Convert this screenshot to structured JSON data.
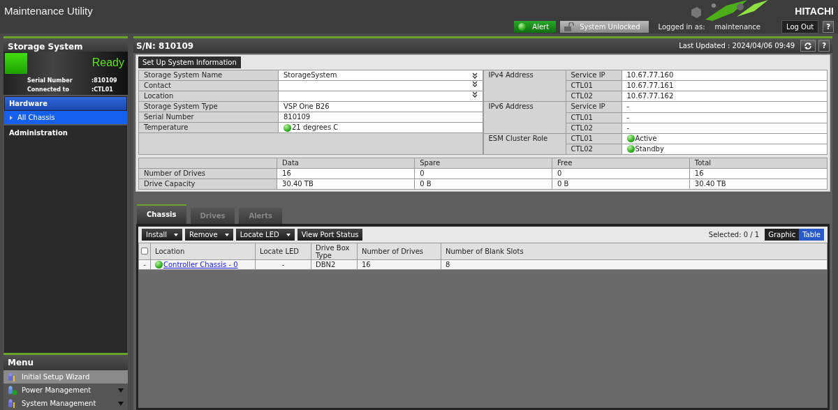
{
  "header": {
    "title": "Maintenance Utility",
    "brand": "HITACHI",
    "alert": {
      "label": "Alert",
      "healthy": true
    },
    "lock_status": {
      "label": "System Unlocked",
      "locked": false
    },
    "logged_in_label": "Logged in as:",
    "user": "maintenance",
    "logout": "Log Out",
    "help": "?"
  },
  "sidebar": {
    "title": "Storage System",
    "status": "Ready",
    "serial_label": "Serial Number",
    "serial_value": ":810109",
    "connected_label": "Connected to",
    "connected_value": ":CTL01",
    "nav": [
      {
        "label": "Hardware",
        "expanded": true,
        "children": [
          {
            "label": "All Chassis",
            "selected": true
          }
        ]
      },
      {
        "label": "Administration",
        "expanded": false
      }
    ],
    "menu": {
      "title": "Menu",
      "items": [
        {
          "label": "Initial Setup Wizard",
          "selected": true,
          "expandable": false
        },
        {
          "label": "Power Management",
          "selected": false,
          "expandable": true
        },
        {
          "label": "System Management",
          "selected": false,
          "expandable": true
        }
      ]
    }
  },
  "main": {
    "title": "S/N: 810109",
    "last_updated": "Last Updated : 2024/04/06 09:49",
    "help": "?",
    "setup_button": "Set Up System Information",
    "info": [
      {
        "label": "Storage System Name",
        "value": "StorageSystem",
        "editable": true
      },
      {
        "label": "Contact",
        "editable": true
      },
      {
        "label": "Location",
        "editable": true
      },
      {
        "label": "Storage System Type",
        "value": "VSP One B26",
        "editable": false
      },
      {
        "label": "Serial Number",
        "value": "810109",
        "editable": false
      },
      {
        "label": "Temperature",
        "value": "21 degrees C",
        "editable": false,
        "healthy": true
      }
    ],
    "network": [
      {
        "label": "IPv4 Address",
        "rows": [
          {
            "key": "Service IP",
            "value": "10.67.77.160"
          },
          {
            "key": "CTL01",
            "value": "10.67.77.161"
          },
          {
            "key": "CTL02",
            "value": "10.67.77.162"
          }
        ]
      },
      {
        "label": "IPv6 Address",
        "rows": [
          {
            "key": "Service IP",
            "value": "-"
          },
          {
            "key": "CTL01",
            "value": "-"
          },
          {
            "key": "CTL02",
            "value": "-"
          }
        ]
      },
      {
        "label": "ESM Cluster Role",
        "rows": [
          {
            "key": "CTL01",
            "value": "Active",
            "healthy": true
          },
          {
            "key": "CTL02",
            "value": "Standby",
            "healthy": true
          }
        ]
      }
    ],
    "drives": {
      "columns": [
        "Data",
        "Spare",
        "Free",
        "Total"
      ],
      "rows": [
        {
          "label": "Number of Drives",
          "cells": [
            "16",
            "0",
            "0",
            "16"
          ]
        },
        {
          "label": "Drive Capacity",
          "cells": [
            "30.40 TB",
            "0 B",
            "0 B",
            "30.40 TB"
          ]
        }
      ]
    },
    "tabs": [
      {
        "label": "Chassis",
        "selected": true
      },
      {
        "label": "Drives",
        "selected": false
      },
      {
        "label": "Alerts",
        "selected": false
      }
    ],
    "toolbar": [
      {
        "label": "Install",
        "dropdown": true
      },
      {
        "label": "Remove",
        "dropdown": true
      },
      {
        "label": "Locate LED",
        "dropdown": true
      },
      {
        "label": "View Port Status",
        "dropdown": false
      }
    ],
    "selected_count": "Selected: 0 / 1",
    "views": [
      {
        "label": "Graphic",
        "selected": false
      },
      {
        "label": "Table",
        "selected": true
      }
    ],
    "table": {
      "select_all_checked": false,
      "columns": [
        "Location",
        "Locate LED",
        "Drive Box Type",
        "Number of Drives",
        "Number of Blank Slots"
      ],
      "rows": [
        {
          "marker": "-",
          "location": "Controller Chassis - 0",
          "healthy": true,
          "locate_led": "-",
          "drive_box_type": "DBN2",
          "drives": "16",
          "blank_slots": "8"
        }
      ]
    }
  }
}
